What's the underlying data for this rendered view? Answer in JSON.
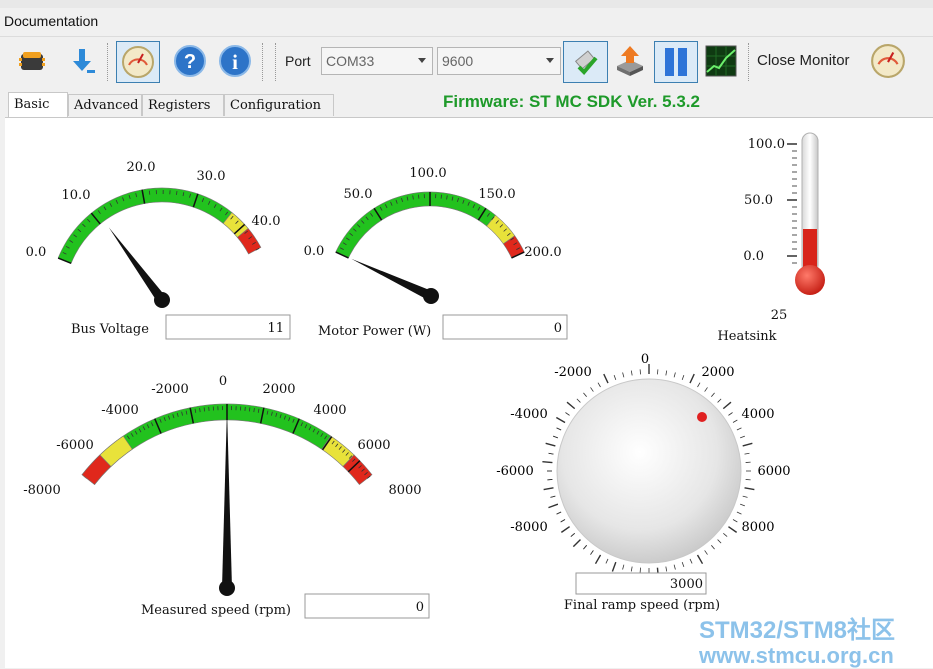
{
  "menu": {
    "documentation": "Documentation"
  },
  "toolbar": {
    "port_label": "Port",
    "port_value": "COM33",
    "baud_value": "9600",
    "close_monitor": "Close Monitor"
  },
  "tabs": [
    "Basic",
    "Advanced",
    "Registers",
    "Configuration"
  ],
  "firmware": "Firmware: ST MC SDK Ver. 5.3.2",
  "gauges": {
    "bus_voltage": {
      "label": "Bus Voltage",
      "value": "11",
      "ticks": [
        "0.0",
        "10.0",
        "20.0",
        "30.0",
        "40.0"
      ],
      "min": 0,
      "max": 45,
      "reading": 11
    },
    "motor_power": {
      "label": "Motor Power (W)",
      "value": "0",
      "ticks": [
        "0.0",
        "50.0",
        "100.0",
        "150.0",
        "200.0"
      ],
      "min": 0,
      "max": 200,
      "reading": 0
    },
    "measured_speed": {
      "label": "Measured speed (rpm)",
      "value": "0",
      "ticks": [
        "-8000",
        "-6000",
        "-4000",
        "-2000",
        "0",
        "2000",
        "4000",
        "6000",
        "8000"
      ],
      "min": -9000,
      "max": 9000,
      "reading": 0
    }
  },
  "heatsink": {
    "label": "Heatsink",
    "value": "25",
    "ticks": [
      "100.0",
      "50.0",
      "0.0"
    ]
  },
  "knob": {
    "label": "Final ramp speed (rpm)",
    "value": "3000",
    "ticks": [
      "0",
      "2000",
      "4000",
      "6000",
      "8000",
      "-2000",
      "-4000",
      "-6000",
      "-8000"
    ]
  },
  "colors": {
    "green": "#22c21e",
    "yellow": "#e8e23a",
    "red": "#e0281c",
    "firmware": "#1e9a2a"
  },
  "watermark": {
    "line1": "STM32/STM8社区",
    "line2": "www.stmcu.org.cn"
  }
}
